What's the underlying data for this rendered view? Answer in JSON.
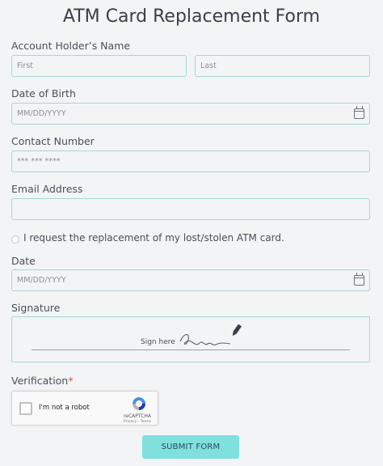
{
  "form": {
    "title": "ATM Card Replacement Form",
    "account_holder_label": "Account Holder’s Name",
    "first_placeholder": "First",
    "last_placeholder": "Last",
    "dob_label": "Date of Birth",
    "dob_placeholder": "MM/DD/YYYY",
    "contact_label": "Contact Number",
    "contact_placeholder": "*** *** ****",
    "email_label": "Email Address",
    "email_value": "",
    "request_text": "I request the replacement of my lost/stolen ATM card.",
    "date_label": "Date",
    "date_placeholder": "MM/DD/YYYY",
    "signature_label": "Signature",
    "sign_here": "Sign here",
    "verification_label": "Verification",
    "required_mark": "*",
    "submit_label": "SUBMIT FORM"
  },
  "captcha": {
    "checkbox_label": "I'm not a robot",
    "brand": "reCAPTCHA",
    "links": "Privacy - Terms"
  },
  "colors": {
    "accent_border": "#a7d7d4",
    "submit_bg": "#7fe0de",
    "required": "#d9534f"
  },
  "icons": [
    "calendar-icon",
    "pen-signature-icon",
    "recaptcha-logo-icon"
  ]
}
